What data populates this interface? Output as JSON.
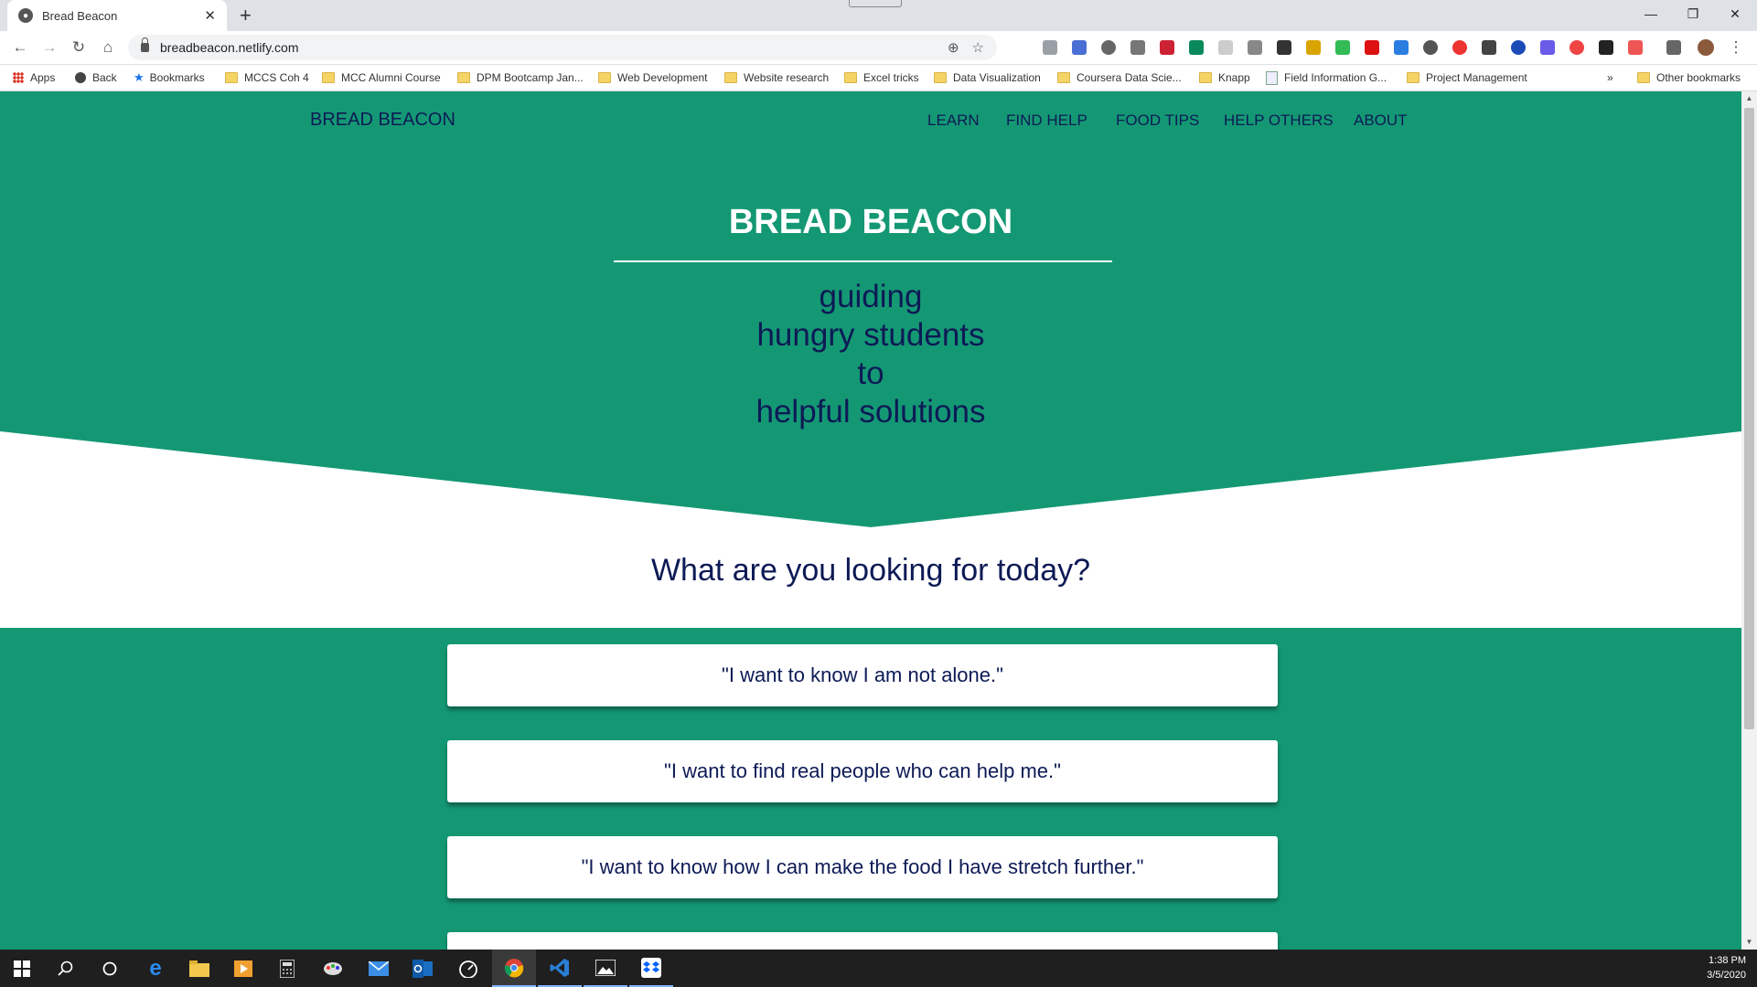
{
  "browser": {
    "tab_title": "Bread Beacon",
    "url": "breadbeacon.netlify.com",
    "bookmarks": [
      {
        "label": "Apps",
        "icon": "apps-grid-icon"
      },
      {
        "label": "Back",
        "icon": "globe-icon"
      },
      {
        "label": "Bookmarks",
        "icon": "star-icon"
      },
      {
        "label": "MCCS Coh 4",
        "icon": "folder-icon"
      },
      {
        "label": "MCC Alumni Course",
        "icon": "folder-icon"
      },
      {
        "label": "DPM Bootcamp Jan...",
        "icon": "folder-icon"
      },
      {
        "label": "Web Development",
        "icon": "folder-icon"
      },
      {
        "label": "Website research",
        "icon": "folder-icon"
      },
      {
        "label": "Excel tricks",
        "icon": "folder-icon"
      },
      {
        "label": "Data Visualization",
        "icon": "folder-icon"
      },
      {
        "label": "Coursera Data Scie...",
        "icon": "folder-icon"
      },
      {
        "label": "Knapp",
        "icon": "folder-icon"
      },
      {
        "label": "Field Information G...",
        "icon": "document-icon"
      },
      {
        "label": "Project Management",
        "icon": "folder-icon"
      }
    ],
    "more_bookmarks": "»",
    "other_bookmarks": "Other bookmarks"
  },
  "site": {
    "brand": "BREAD BEACON",
    "nav": [
      "LEARN",
      "FIND HELP",
      "FOOD TIPS",
      "HELP OTHERS",
      "ABOUT"
    ],
    "hero_title": "BREAD BEACON",
    "tagline_lines": [
      "guiding",
      "hungry students",
      "to",
      "helpful solutions"
    ],
    "question": "What are you looking for today?",
    "options": [
      "\"I want to know I am not alone.\"",
      "\"I want to find real people who can help me.\"",
      "\"I want to know how I can make the food I have stretch further.\""
    ],
    "colors": {
      "teal": "#149874",
      "navy": "#0d1a55",
      "white": "#ffffff"
    }
  },
  "taskbar": {
    "time": "1:38 PM",
    "date": "3/5/2020"
  }
}
